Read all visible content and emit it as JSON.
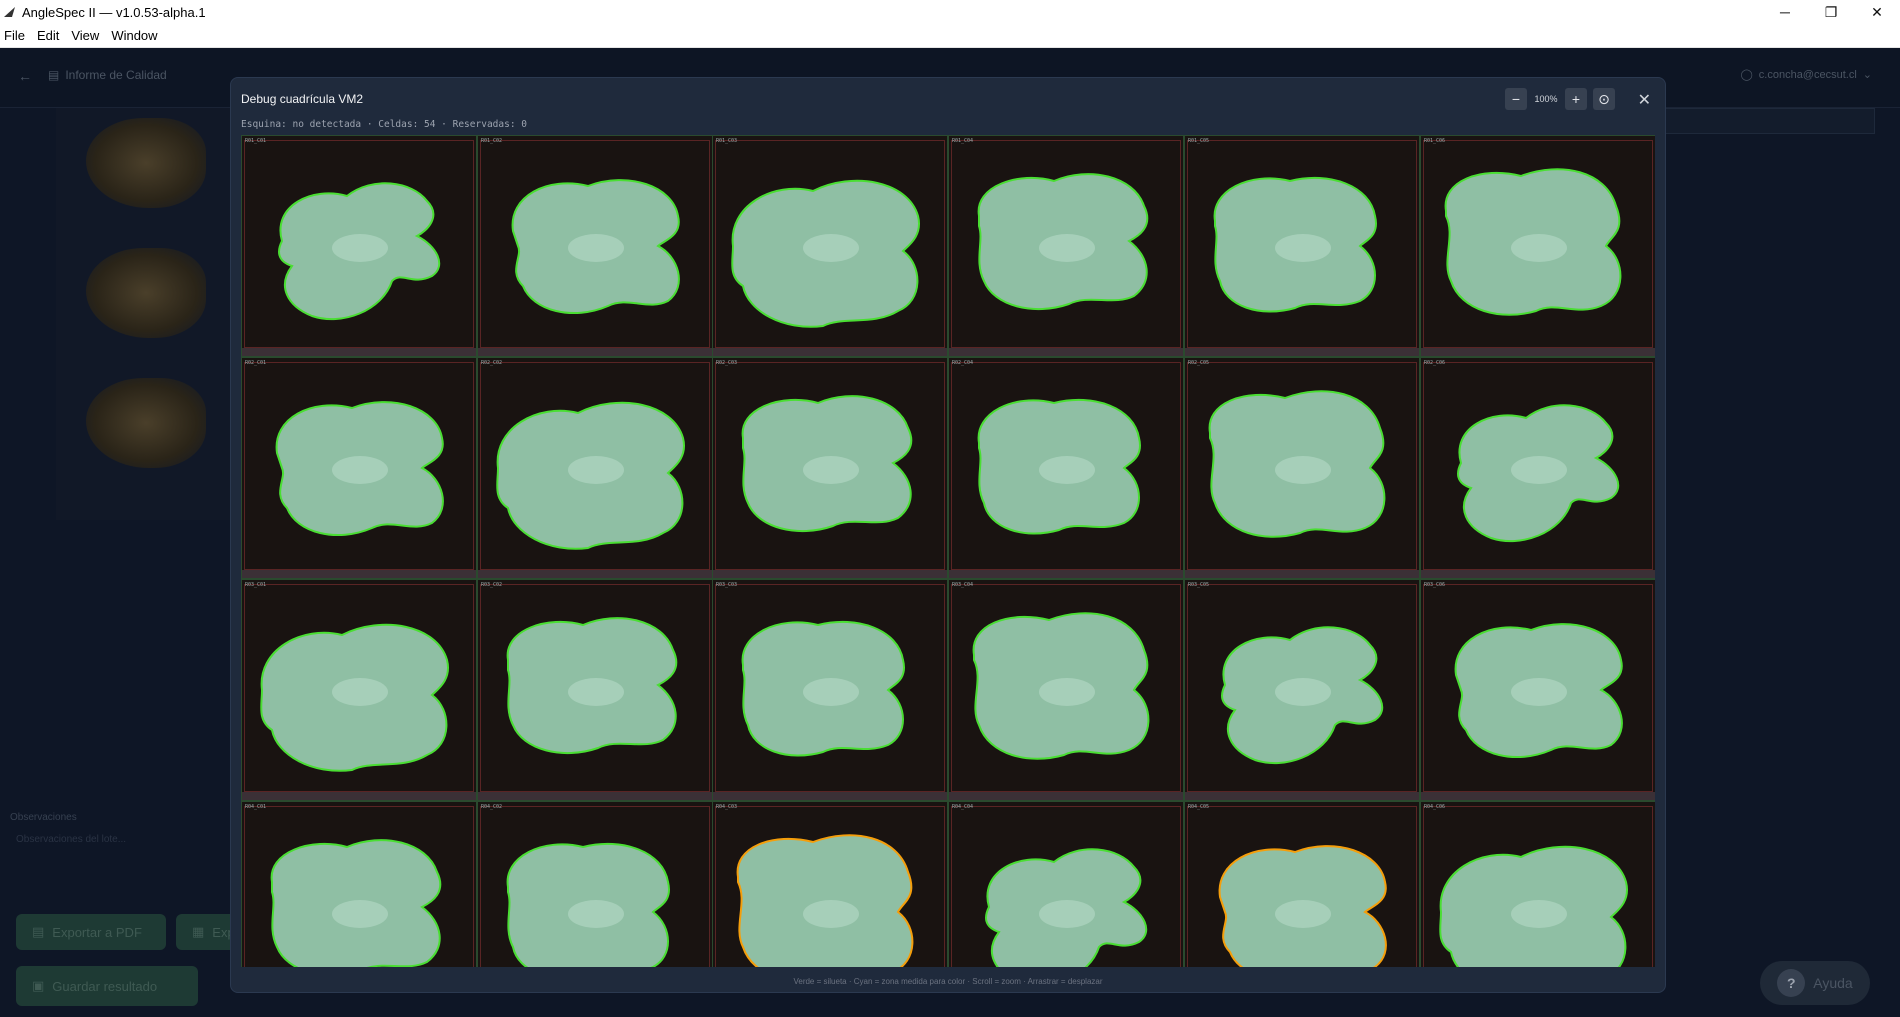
{
  "window": {
    "title": "AngleSpec II — v1.0.53-alpha.1",
    "controls": [
      "─",
      "❐",
      "✕"
    ]
  },
  "menu": [
    "File",
    "Edit",
    "View",
    "Window"
  ],
  "background_app": {
    "page_title": "Informe de Calidad",
    "user": "c.concha@cecsut.cl",
    "observations_label": "Observaciones",
    "observations_placeholder": "Observaciones del lote...",
    "export_pdf_label": "Exportar a PDF",
    "export_excel_label": "Exp",
    "save_label": "Guardar resultado",
    "help_label": "Ayuda"
  },
  "modal": {
    "title": "Debug cuadrícula VM2",
    "subtitle": "Esquina: no detectada · Celdas: 54 · Reservadas: 0",
    "zoom_out": "−",
    "zoom_level": "100%",
    "zoom_in": "+",
    "zoom_reset": "⊙",
    "close": "✕",
    "footer_hint": "Verde = silueta · Cyan = zona medida para color · Scroll = zoom · Arrastrar = desplazar"
  },
  "grid": {
    "rows": 4,
    "cols": 6,
    "cells": [
      {
        "label": "R01_C01",
        "outline": "green"
      },
      {
        "label": "R01_C02",
        "outline": "green"
      },
      {
        "label": "R01_C03",
        "outline": "green"
      },
      {
        "label": "R01_C04",
        "outline": "green"
      },
      {
        "label": "R01_C05",
        "outline": "green"
      },
      {
        "label": "R01_C06",
        "outline": "green"
      },
      {
        "label": "R02_C01",
        "outline": "green"
      },
      {
        "label": "R02_C02",
        "outline": "green"
      },
      {
        "label": "R02_C03",
        "outline": "green"
      },
      {
        "label": "R02_C04",
        "outline": "green"
      },
      {
        "label": "R02_C05",
        "outline": "green"
      },
      {
        "label": "R02_C06",
        "outline": "green"
      },
      {
        "label": "R03_C01",
        "outline": "green"
      },
      {
        "label": "R03_C02",
        "outline": "green"
      },
      {
        "label": "R03_C03",
        "outline": "green"
      },
      {
        "label": "R03_C04",
        "outline": "green"
      },
      {
        "label": "R03_C05",
        "outline": "green"
      },
      {
        "label": "R03_C06",
        "outline": "green"
      },
      {
        "label": "R04_C01",
        "outline": "green"
      },
      {
        "label": "R04_C02",
        "outline": "green"
      },
      {
        "label": "R04_C03",
        "outline": "orange"
      },
      {
        "label": "R04_C04",
        "outline": "green"
      },
      {
        "label": "R04_C05",
        "outline": "orange"
      },
      {
        "label": "R04_C06",
        "outline": "green"
      }
    ]
  },
  "colors": {
    "outline_green": "#4ade33",
    "outline_orange": "#f59e0b",
    "walnut_fill": "#8fbfa4",
    "modal_bg": "#1f2a3c"
  }
}
